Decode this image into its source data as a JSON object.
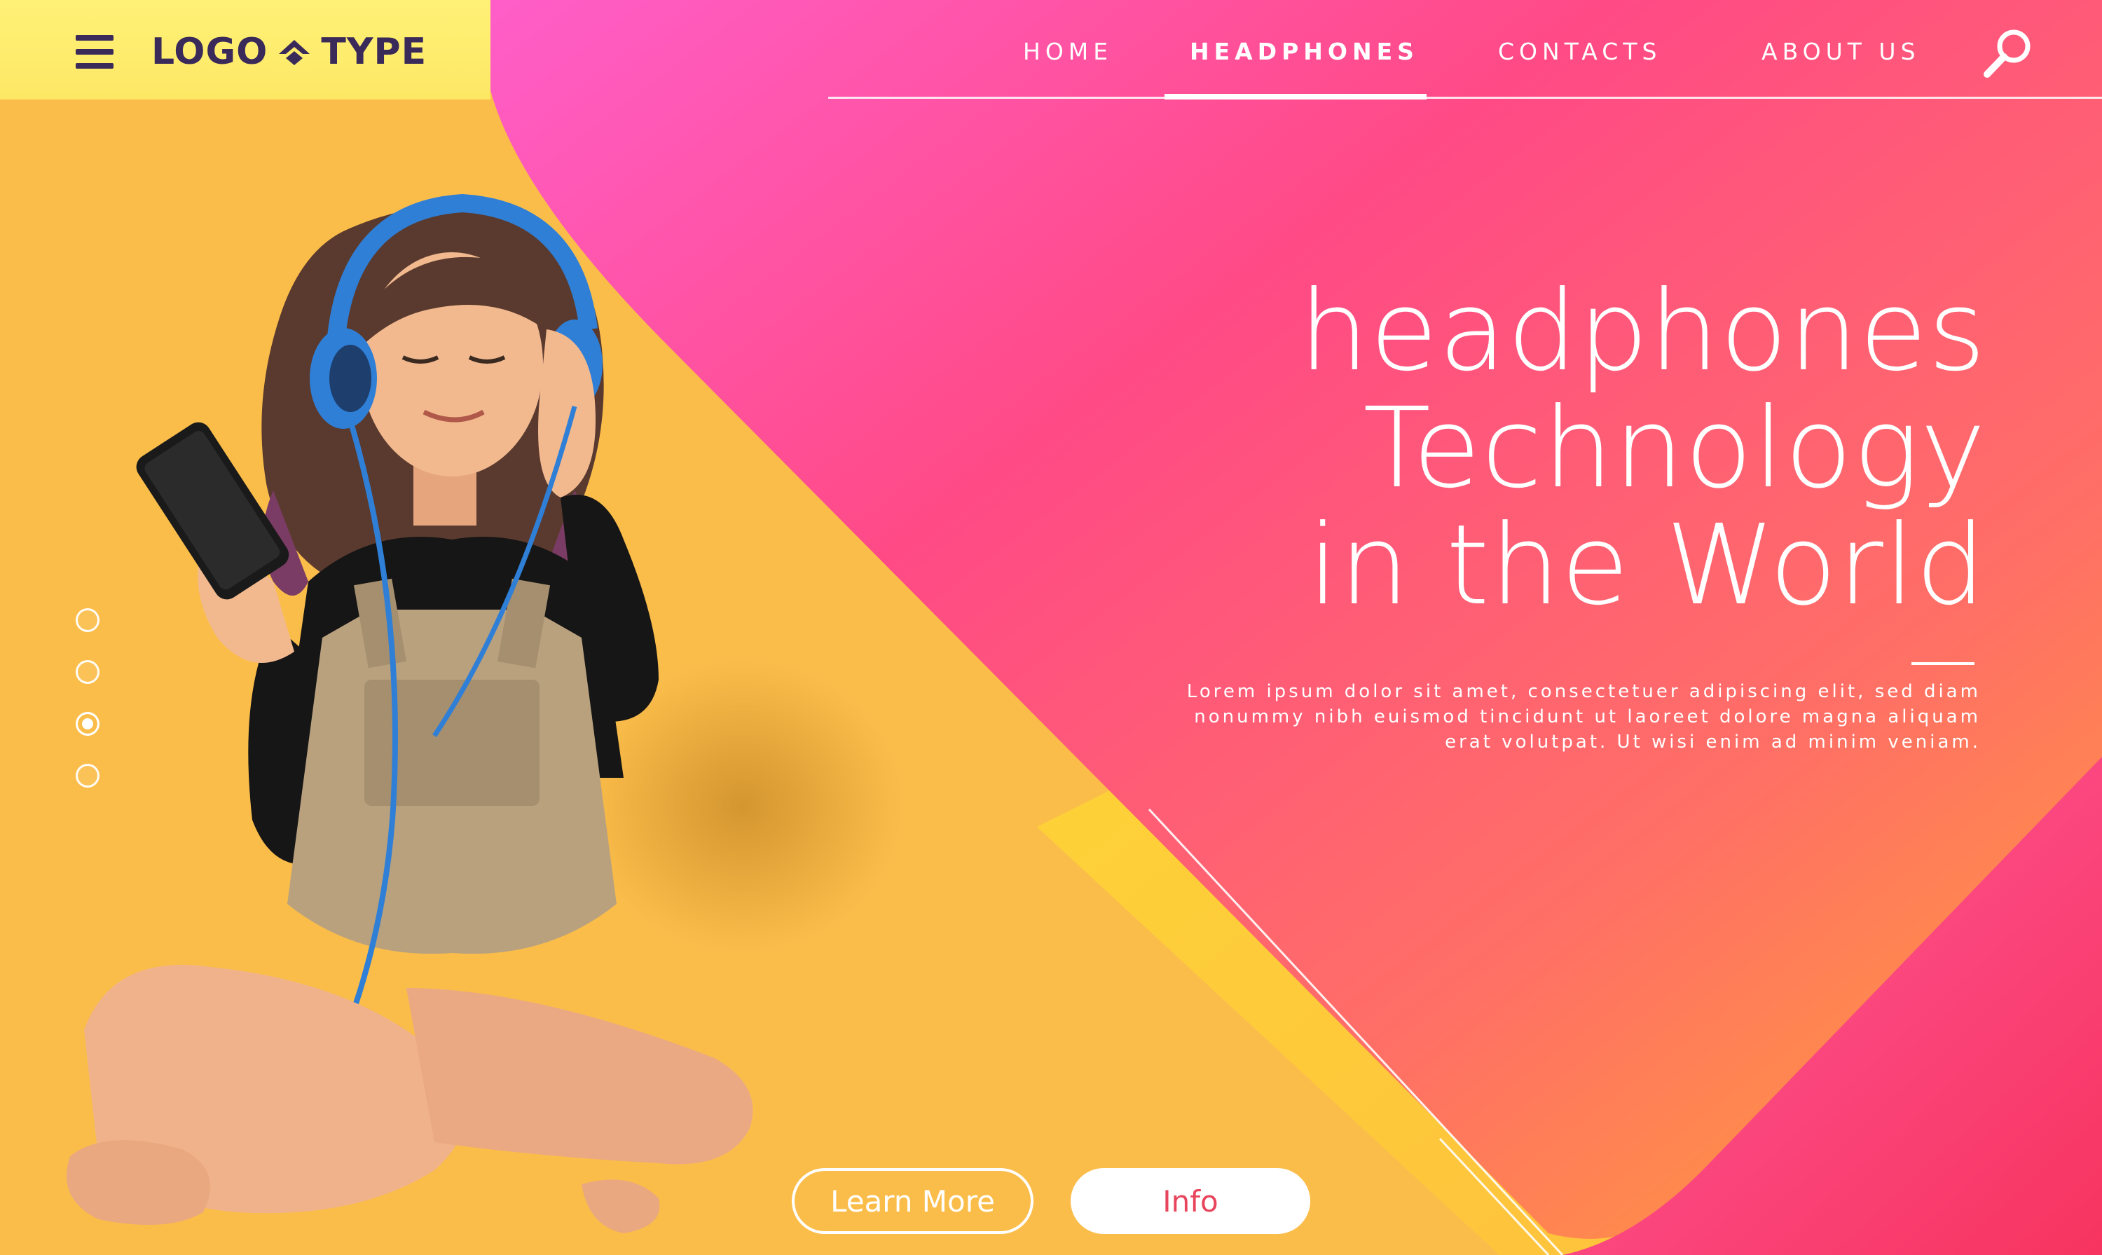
{
  "header": {
    "logo_left": "LOGO",
    "logo_right": "TYPE",
    "nav": [
      {
        "label": "HOME"
      },
      {
        "label": "HEADPHONES"
      },
      {
        "label": "CONTACTS"
      },
      {
        "label": "ABOUT US"
      }
    ],
    "active_nav": "HEADPHONES"
  },
  "hero": {
    "title_lines": [
      "headphones",
      "Technology",
      "in the World"
    ],
    "body_lines": [
      "Lorem ipsum dolor sit amet, consectetuer adipiscing elit, sed diam",
      "nonummy nibh euismod tincidunt ut laoreet dolore magna aliquam",
      "erat volutpat. Ut wisi enim ad minim veniam."
    ]
  },
  "slider": {
    "total": 4,
    "active": 3
  },
  "buttons": {
    "learn_more": "Learn More",
    "info": "Info"
  },
  "icons": [
    "hamburger-icon",
    "logo-arrow-icon",
    "search-icon"
  ],
  "colors": {
    "yellow": "#fbbd4a",
    "pink": "#ff4f8b",
    "orange": "#ff9a3c",
    "magenta": "#f74d9a",
    "logo": "#3a2a5a",
    "info_text": "#e8455c"
  }
}
